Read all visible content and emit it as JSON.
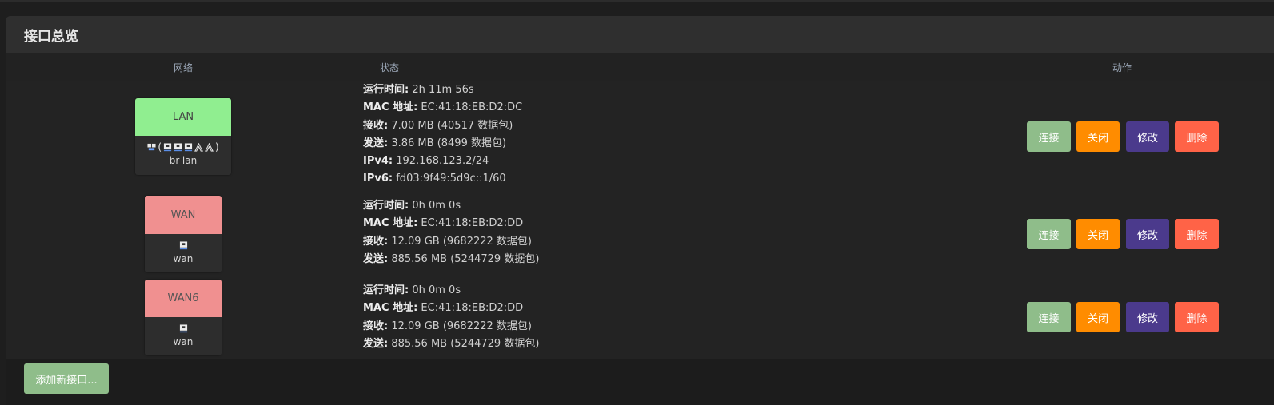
{
  "panel": {
    "title": "接口总览"
  },
  "columns": {
    "network": "网络",
    "status": "状态",
    "actions": "动作"
  },
  "actions": {
    "connect": "连接",
    "close": "关闭",
    "edit": "修改",
    "delete": "删除"
  },
  "colors": {
    "lan_badge": "#90ee90",
    "wan_badge": "#f09090",
    "connect": "#8fbd8a",
    "close": "#ff8c00",
    "edit": "#4b3a8c",
    "delete": "#ff6347"
  },
  "interfaces": [
    {
      "name": "LAN",
      "device": "br-lan",
      "icon_prefix": "(",
      "icon_suffix": ")",
      "icons": [
        "bridge-icon",
        "ethernet-port-icon",
        "ethernet-port-icon",
        "ethernet-port-icon",
        "wifi-icon",
        "wifi-icon"
      ],
      "status": [
        {
          "label": "运行时间:",
          "value": "2h 11m 56s"
        },
        {
          "label": "MAC 地址:",
          "value": "EC:41:18:EB:D2:DC"
        },
        {
          "label": "接收:",
          "value": "7.00 MB (40517 数据包)"
        },
        {
          "label": "发送:",
          "value": "3.86 MB (8499 数据包)"
        },
        {
          "label": "IPv4:",
          "value": "192.168.123.2/24"
        },
        {
          "label": "IPv6:",
          "value": "fd03:9f49:5d9c::1/60"
        }
      ]
    },
    {
      "name": "WAN",
      "device": "wan",
      "icons": [
        "ethernet-port-icon"
      ],
      "status": [
        {
          "label": "运行时间:",
          "value": "0h 0m 0s"
        },
        {
          "label": "MAC 地址:",
          "value": "EC:41:18:EB:D2:DD"
        },
        {
          "label": "接收:",
          "value": "12.09 GB (9682222 数据包)"
        },
        {
          "label": "发送:",
          "value": "885.56 MB (5244729 数据包)"
        }
      ]
    },
    {
      "name": "WAN6",
      "device": "wan",
      "icons": [
        "ethernet-port-icon"
      ],
      "status": [
        {
          "label": "运行时间:",
          "value": "0h 0m 0s"
        },
        {
          "label": "MAC 地址:",
          "value": "EC:41:18:EB:D2:DD"
        },
        {
          "label": "接收:",
          "value": "12.09 GB (9682222 数据包)"
        },
        {
          "label": "发送:",
          "value": "885.56 MB (5244729 数据包)"
        }
      ]
    }
  ],
  "footer": {
    "add_button": "添加新接口..."
  }
}
